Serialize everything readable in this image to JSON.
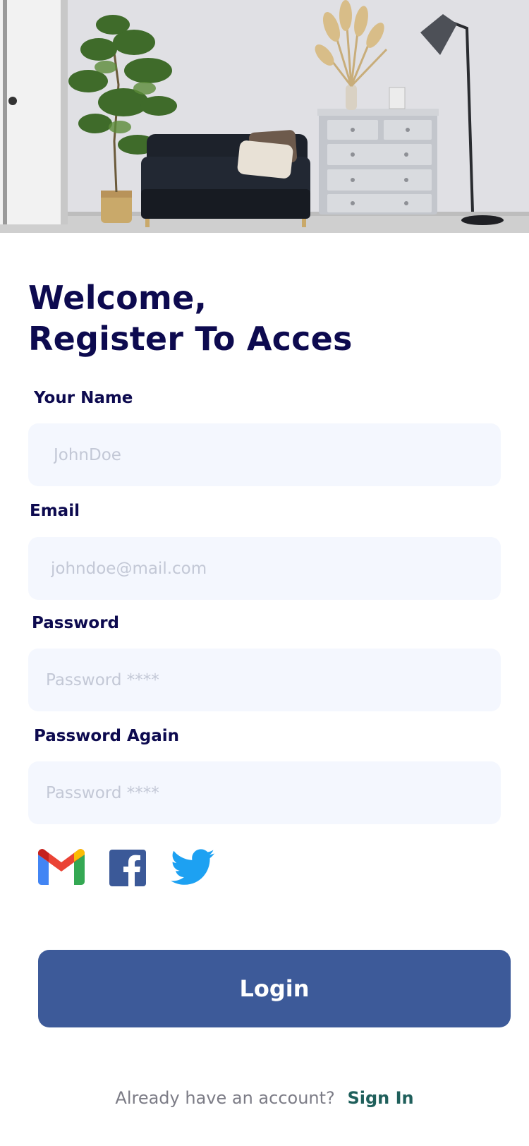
{
  "form": {
    "heading_line1": "Welcome,",
    "heading_line2": "Register To Acces",
    "name_label": "Your Name",
    "name_placeholder": "JohnDoe",
    "email_label": "Email",
    "email_placeholder": "johndoe@mail.com",
    "password_label": "Password",
    "password_placeholder": "Password ****",
    "password_again_label": "Password Again",
    "password_again_placeholder": "Password ****"
  },
  "social": {
    "icons": [
      "gmail-icon",
      "facebook-icon",
      "twitter-icon"
    ],
    "colors": {
      "gmail_red": "#EA4335",
      "gmail_blue": "#4285F4",
      "gmail_green": "#34A853",
      "gmail_yellow": "#FBBC04",
      "facebook": "#3B5998",
      "twitter": "#1DA1F2"
    }
  },
  "actions": {
    "login_label": "Login",
    "login_color": "#3D5A99"
  },
  "footer": {
    "prompt": "Already have an account?",
    "signin_label": "Sign In"
  },
  "theme": {
    "heading_color": "#0D0A4F",
    "input_background": "#F4F7FE",
    "link_color": "#1F5F5B"
  }
}
